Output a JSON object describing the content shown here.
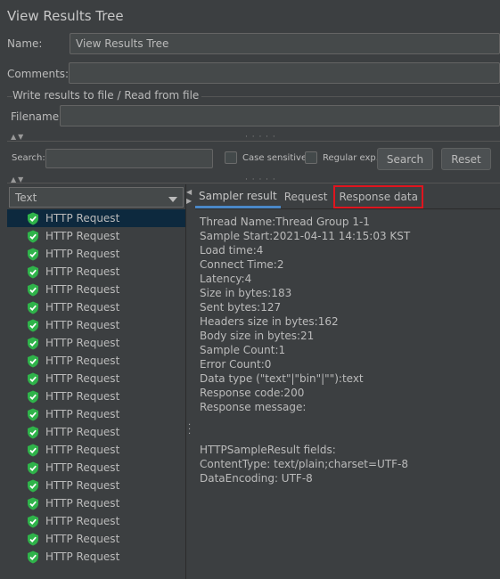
{
  "panel_title": "View Results Tree",
  "name": {
    "label": "Name:",
    "value": "View Results Tree"
  },
  "comments": {
    "label": "Comments:",
    "value": ""
  },
  "file_section": {
    "title": "Write results to file / Read from file",
    "filename_label": "Filename",
    "filename_value": ""
  },
  "search": {
    "label": "Search:",
    "value": "",
    "case_sensitive_label": "Case sensitive",
    "regex_label": "Regular exp.",
    "search_button": "Search",
    "reset_button": "Reset"
  },
  "renderer": {
    "selected": "Text"
  },
  "tree": {
    "items": [
      "HTTP Request",
      "HTTP Request",
      "HTTP Request",
      "HTTP Request",
      "HTTP Request",
      "HTTP Request",
      "HTTP Request",
      "HTTP Request",
      "HTTP Request",
      "HTTP Request",
      "HTTP Request",
      "HTTP Request",
      "HTTP Request",
      "HTTP Request",
      "HTTP Request",
      "HTTP Request",
      "HTTP Request",
      "HTTP Request",
      "HTTP Request",
      "HTTP Request"
    ],
    "selected_index": 0
  },
  "tabs": {
    "sampler_result": "Sampler result",
    "request": "Request",
    "response_data": "Response data"
  },
  "sampler_result": {
    "lines": [
      "Thread Name:Thread Group 1-1",
      "Sample Start:2021-04-11 14:15:03 KST",
      "Load time:4",
      "Connect Time:2",
      "Latency:4",
      "Size in bytes:183",
      "Sent bytes:127",
      "Headers size in bytes:162",
      "Body size in bytes:21",
      "Sample Count:1",
      "Error Count:0",
      "Data type (\"text\"|\"bin\"|\"\"):text",
      "Response code:200",
      "Response message:",
      "",
      "",
      "HTTPSampleResult fields:",
      "ContentType: text/plain;charset=UTF-8",
      "DataEncoding: UTF-8"
    ]
  },
  "colors": {
    "highlight_box": "#e0141e",
    "tab_underline": "#4a88c7",
    "success_icon": "#2fb34a"
  }
}
